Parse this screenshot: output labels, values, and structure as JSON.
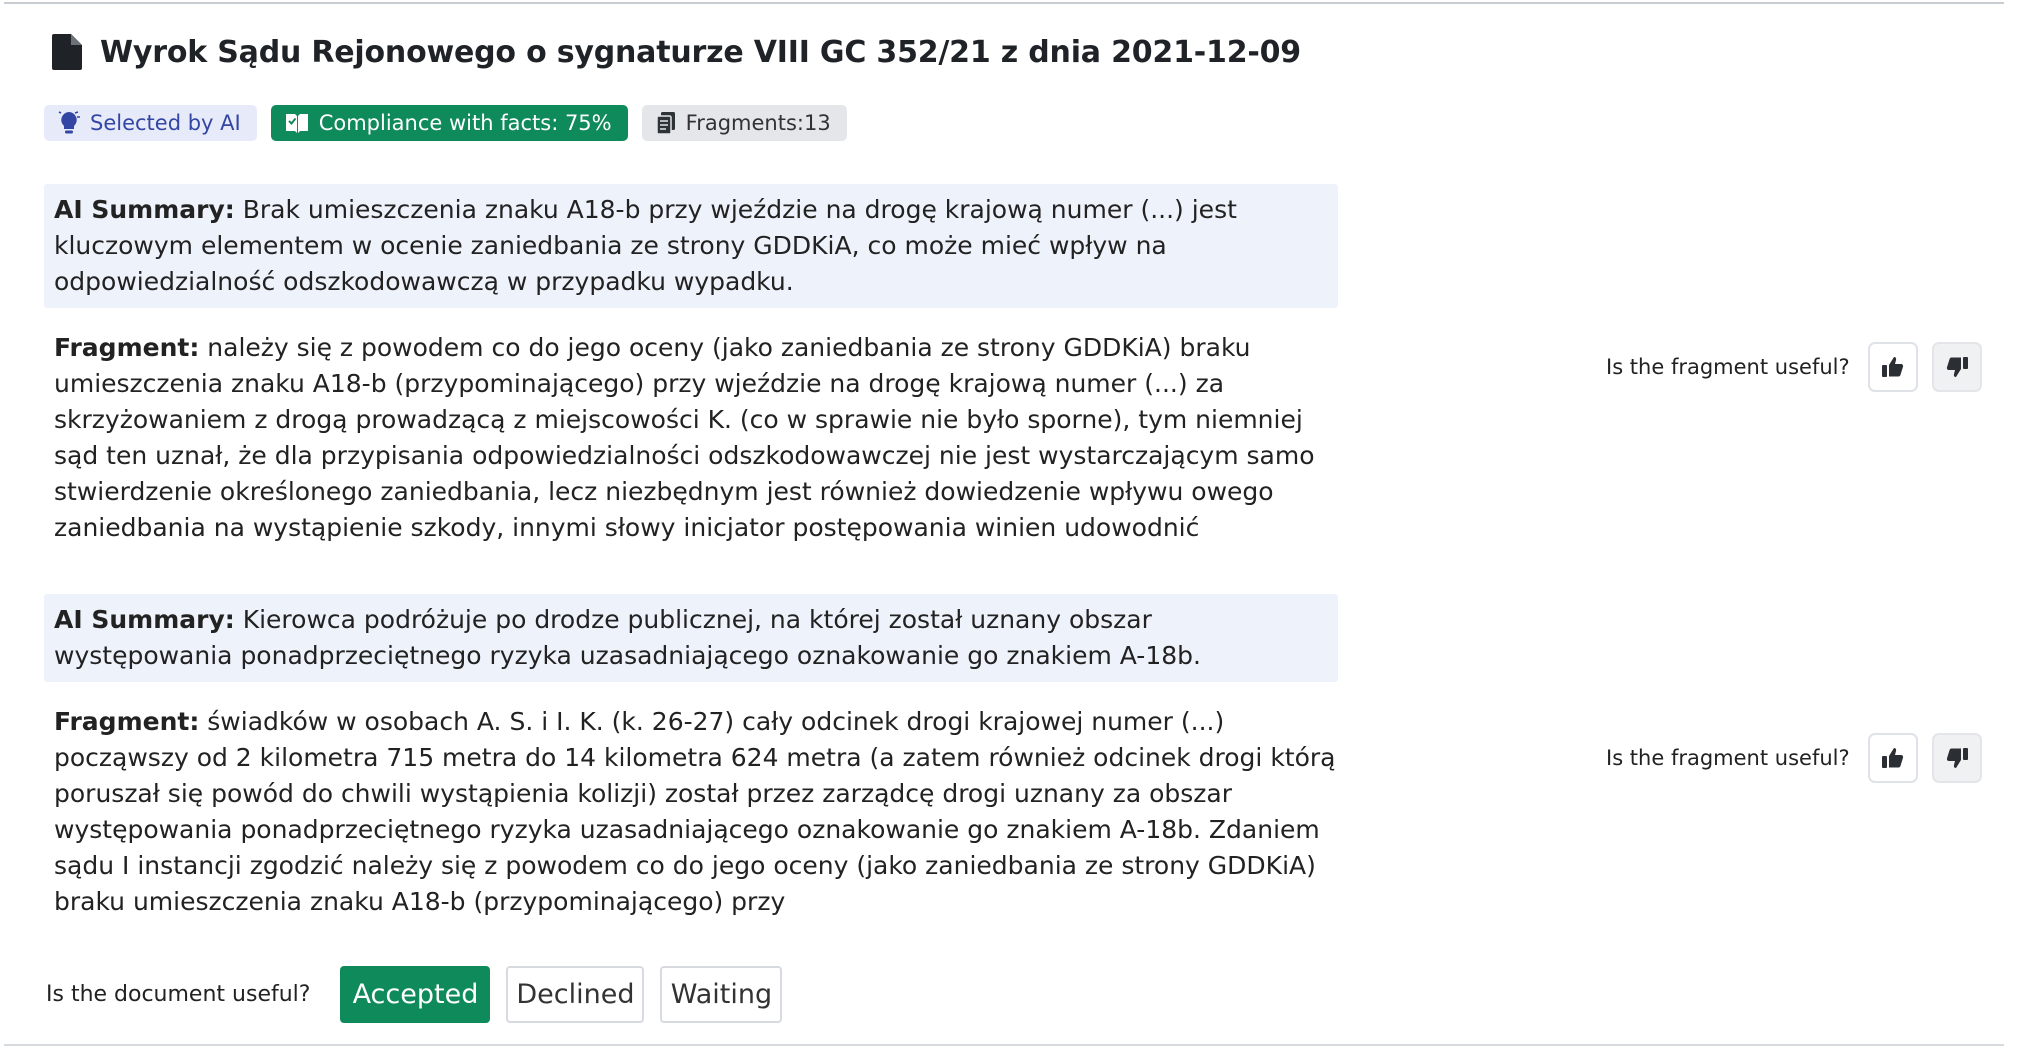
{
  "document": {
    "title": "Wyrok Sądu Rejonowego o sygnaturze VIII GC 352/21 z dnia 2021-12-09",
    "icon": "document-icon"
  },
  "badges": {
    "selected": "Selected by AI",
    "compliance": "Compliance with facts: 75%",
    "fragments": "Fragments:13"
  },
  "labels": {
    "ai_summary": "AI Summary:",
    "fragment": "Fragment:",
    "fragment_useful": "Is the fragment useful?",
    "document_useful": "Is the document useful?"
  },
  "results": [
    {
      "summary": "Brak umieszczenia znaku A18-b przy wjeździe na drogę krajową numer (...) jest kluczowym elementem w ocenie zaniedbania ze strony GDDKiA, co może mieć wpływ na odpowiedzialność odszkodowawczą w przypadku wypadku.",
      "fragment": "należy się z powodem co do jego oceny (jako zaniedbania ze strony GDDKiA) braku umieszczenia znaku A18-b (przypominającego) przy wjeździe na drogę krajową numer (...) za skrzyżowaniem z drogą prowadzącą z miejscowości K. (co w sprawie nie było sporne), tym niemniej sąd ten uznał, że dla przypisania odpowiedzialności odszkodowawczej nie jest wystarczającym samo stwierdzenie określonego zaniedbania, lecz niezbędnym jest również dowiedzenie wpływu owego zaniedbania na wystąpienie szkody, innymi słowy inicjator postępowania winien udowodnić"
    },
    {
      "summary": "Kierowca podróżuje po drodze publicznej, na której został uznany obszar występowania ponadprzeciętnego ryzyka uzasadniającego oznakowanie go znakiem A-18b.",
      "fragment": "świadków w osobach A. S. i I. K. (k. 26-27) cały odcinek drogi krajowej numer (...) począwszy od 2 kilometra 715 metra do 14 kilometra 624 metra (a zatem również odcinek drogi którą poruszał się powód do chwili wystąpienia kolizji) został przez zarządcę drogi uznany za obszar występowania ponadprzeciętnego ryzyka uzasadniającego oznakowanie go znakiem A-18b. Zdaniem sądu I instancji zgodzić należy się z powodem co do jego oceny (jako zaniedbania ze strony GDDKiA) braku umieszczenia znaku A18-b (przypominającego) przy"
    }
  ],
  "decision": {
    "options": [
      "Accepted",
      "Declined",
      "Waiting"
    ],
    "selected": "Accepted"
  },
  "colors": {
    "accent_green": "#0f8a5a",
    "ai_badge_bg": "#e7ebf9",
    "ai_badge_text": "#3446a3",
    "summary_bg": "#eef2fb"
  }
}
